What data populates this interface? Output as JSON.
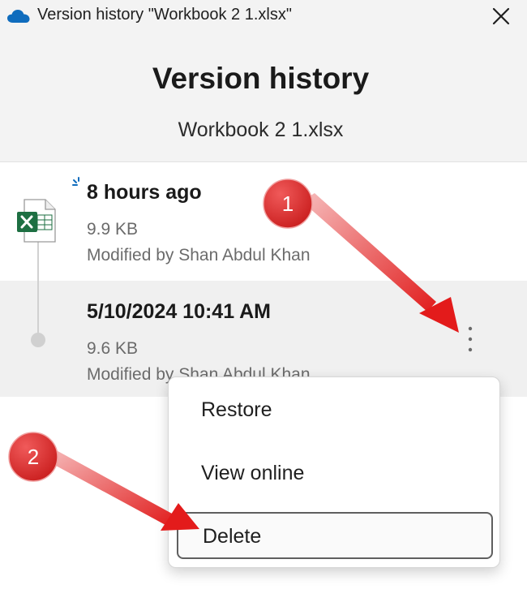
{
  "window": {
    "title": "Version history \"Workbook 2 1.xlsx\"",
    "cloud_icon": "onedrive-cloud-icon",
    "close_icon": "close-icon"
  },
  "header": {
    "title": "Version history",
    "file_name": "Workbook 2 1.xlsx"
  },
  "versions": [
    {
      "time": "8 hours ago",
      "size": "9.9 KB",
      "modified_by": "Modified by Shan Abdul Khan",
      "icon": "excel-file-icon"
    },
    {
      "time": "5/10/2024 10:41 AM",
      "size": "9.6 KB",
      "modified_by": "Modified by Shan Abdul Khan"
    }
  ],
  "context_menu": {
    "items": [
      "Restore",
      "View online",
      "Delete"
    ]
  },
  "annotations": {
    "badges": [
      "1",
      "2"
    ],
    "color": "#e52d2d"
  },
  "colors": {
    "excel_green": "#1d6f42",
    "onedrive_blue": "#0f6cbd",
    "header_bg": "#f3f3f3",
    "selected_row_bg": "#f0f0f0"
  }
}
